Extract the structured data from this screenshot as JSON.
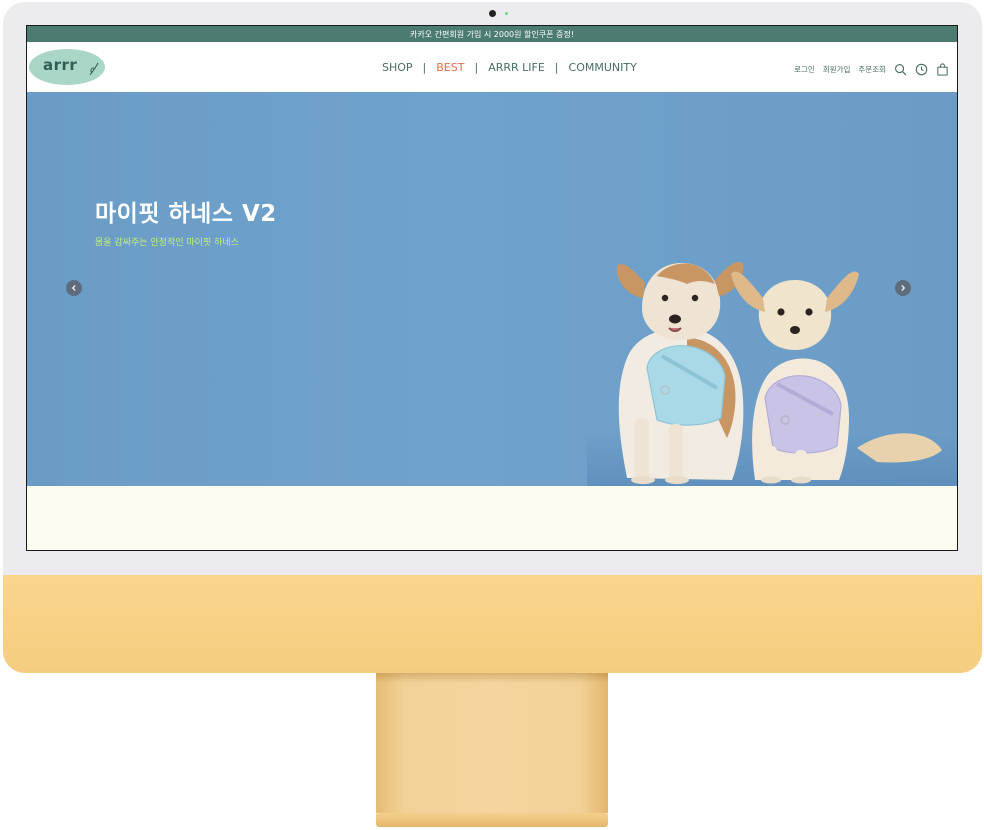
{
  "promo_bar": {
    "text": "카카오 간편회원 가입 시 2000원 할인쿠폰 증정!"
  },
  "logo": {
    "text": "arrr"
  },
  "nav": {
    "items": [
      {
        "label": "SHOP",
        "active": false
      },
      {
        "label": "BEST",
        "active": true
      },
      {
        "label": "ARRR LIFE",
        "active": false
      },
      {
        "label": "COMMUNITY",
        "active": false
      }
    ],
    "separator": "|"
  },
  "utility": {
    "login": "로그인",
    "signup": "회원가입",
    "order_lookup": "주문조회",
    "icons": [
      "search-icon",
      "clock-icon",
      "shopping-bag-icon"
    ]
  },
  "hero": {
    "title": "마이핏 하네스 V2",
    "subtitle": "몸을 감싸주는 안정적인 마이핏 하네스",
    "prev_icon": "chevron-left-icon",
    "next_icon": "chevron-right-icon"
  },
  "colors": {
    "promo_bar": "#4c7b72",
    "nav_text": "#4a6d66",
    "nav_active": "#e36f4f",
    "hero_bg": "#6fa2cc",
    "hero_subtitle": "#c4f07a",
    "logo_blob": "#a9d6c7",
    "cream_section": "#fefcf0",
    "imac_chin": "#f7cf84"
  }
}
